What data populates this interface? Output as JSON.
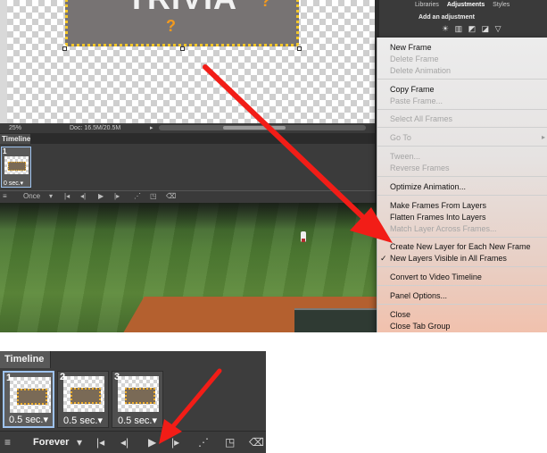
{
  "top": {
    "canvas": {
      "sign_title": "TRIVIA",
      "question_mark": "?",
      "zoom": "25%",
      "doc_info": "Doc: 16.5M/20.5M"
    },
    "right_panel": {
      "tabs": [
        "Libraries",
        "Adjustments",
        "Styles"
      ],
      "add_adjustment": "Add an adjustment",
      "icons": "☀ ▥ ◩ ◪ ▽"
    },
    "timeline_tab": "Timeline",
    "frame": {
      "number": "1",
      "duration": "0 sec.▾"
    },
    "loop": "Once",
    "menu": {
      "new_frame": "New Frame",
      "delete_frame": "Delete Frame",
      "delete_animation": "Delete Animation",
      "copy_frame": "Copy Frame",
      "paste_frame": "Paste Frame...",
      "select_all_frames": "Select All Frames",
      "go_to": "Go To",
      "tween": "Tween...",
      "reverse_frames": "Reverse Frames",
      "optimize_animation": "Optimize Animation...",
      "make_frames_from_layers": "Make Frames From Layers",
      "flatten_frames_into_layers": "Flatten Frames Into Layers",
      "match_layer_across_frames": "Match Layer Across Frames...",
      "create_new_layer": "Create New Layer for Each New Frame",
      "new_layers_visible": "New Layers Visible in All Frames",
      "checkmark": "✓",
      "convert_to_video": "Convert to Video Timeline",
      "panel_options": "Panel Options...",
      "close": "Close",
      "close_tab_group": "Close Tab Group",
      "submenu_arrow": "▸"
    }
  },
  "bottom": {
    "timeline_tab": "Timeline",
    "frames": [
      {
        "number": "1",
        "duration": "0.5 sec.▾"
      },
      {
        "number": "2",
        "duration": "0.5 sec.▾"
      },
      {
        "number": "3",
        "duration": "0.5 sec.▾"
      }
    ],
    "loop": "Forever"
  },
  "colors": {
    "arrow": "#f21d17",
    "selection": "#9ec3ef"
  }
}
